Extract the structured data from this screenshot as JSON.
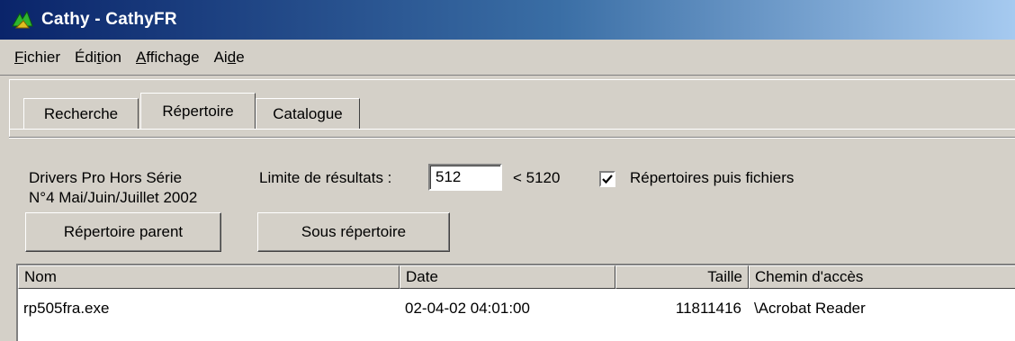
{
  "window": {
    "title": "Cathy - CathyFR"
  },
  "menu": [
    {
      "pre": "",
      "u": "F",
      "post": "ichier"
    },
    {
      "pre": "Édi",
      "u": "t",
      "post": "ion"
    },
    {
      "pre": "",
      "u": "A",
      "post": "ffichage"
    },
    {
      "pre": "Ai",
      "u": "d",
      "post": "e"
    }
  ],
  "tabs": [
    "Recherche",
    "Répertoire",
    "Catalogue"
  ],
  "active_tab": "Répertoire",
  "panel": {
    "catalog_line1": "Drivers Pro Hors Série",
    "catalog_line2": "N°4 Mai/Juin/Juillet 2002",
    "limit_label": "Limite de résultats :",
    "limit_value": "512",
    "limit_max": "< 5120",
    "dirs_first_checked": true,
    "dirs_first_label": "Répertoires puis fichiers",
    "parent_button": "Répertoire parent",
    "subdir_button": "Sous répertoire"
  },
  "list": {
    "columns": [
      "Nom",
      "Date",
      "Taille",
      "Chemin d'accès"
    ],
    "rows": [
      {
        "name": "rp505fra.exe",
        "date": "02-04-02 04:01:00",
        "size": "11811416",
        "path": "\\Acrobat Reader"
      }
    ]
  },
  "colors": {
    "title_start": "#0a246a",
    "title_end": "#a6caf0",
    "face": "#d4d0c8"
  }
}
